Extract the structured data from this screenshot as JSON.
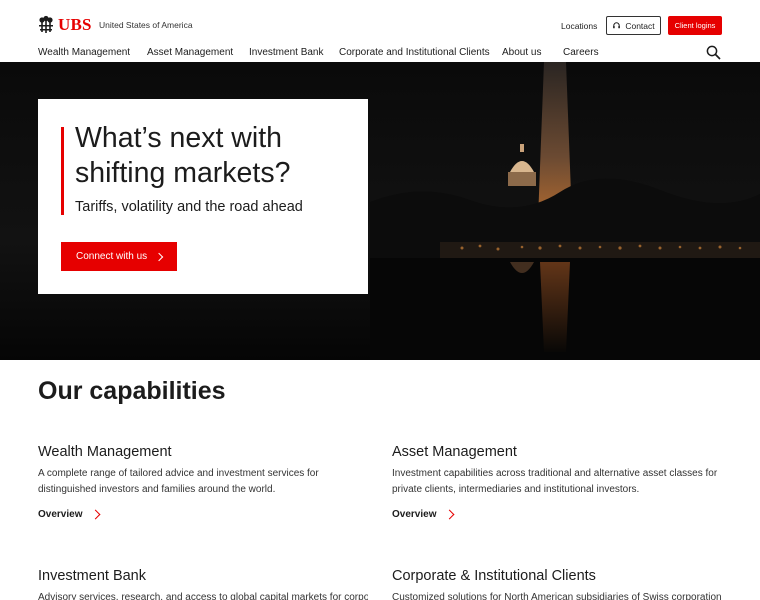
{
  "brand": {
    "name": "UBS",
    "region": "United States of America",
    "accent_color": "#e60000"
  },
  "utility": {
    "locations": "Locations",
    "contact": "Contact",
    "client_logins": "Client logins",
    "contact_icon": "headset-icon",
    "search_icon": "search-icon"
  },
  "nav": {
    "items": [
      "Wealth Management",
      "Asset Management",
      "Investment Bank",
      "Corporate and Institutional Clients",
      "About us",
      "Careers"
    ]
  },
  "hero": {
    "title": "What’s next with shifting markets?",
    "subtitle": "Tariffs, volatility and the road ahead",
    "cta": "Connect with us"
  },
  "capabilities": {
    "title": "Our capabilities",
    "items": [
      {
        "title": "Wealth Management",
        "description": "A complete range of tailored advice and investment services for distinguished investors and families around the world.",
        "link": "Overview"
      },
      {
        "title": "Asset Management",
        "description": "Investment capabilities across traditional and alternative asset classes for private clients, intermediaries and institutional investors.",
        "link": "Overview"
      },
      {
        "title": "Investment Bank",
        "description": "Advisory services, research, and access to global capital markets for corporate and"
      },
      {
        "title": "Corporate & Institutional Clients",
        "description": "Customized solutions for North American subsidiaries of Swiss corporations"
      }
    ]
  }
}
